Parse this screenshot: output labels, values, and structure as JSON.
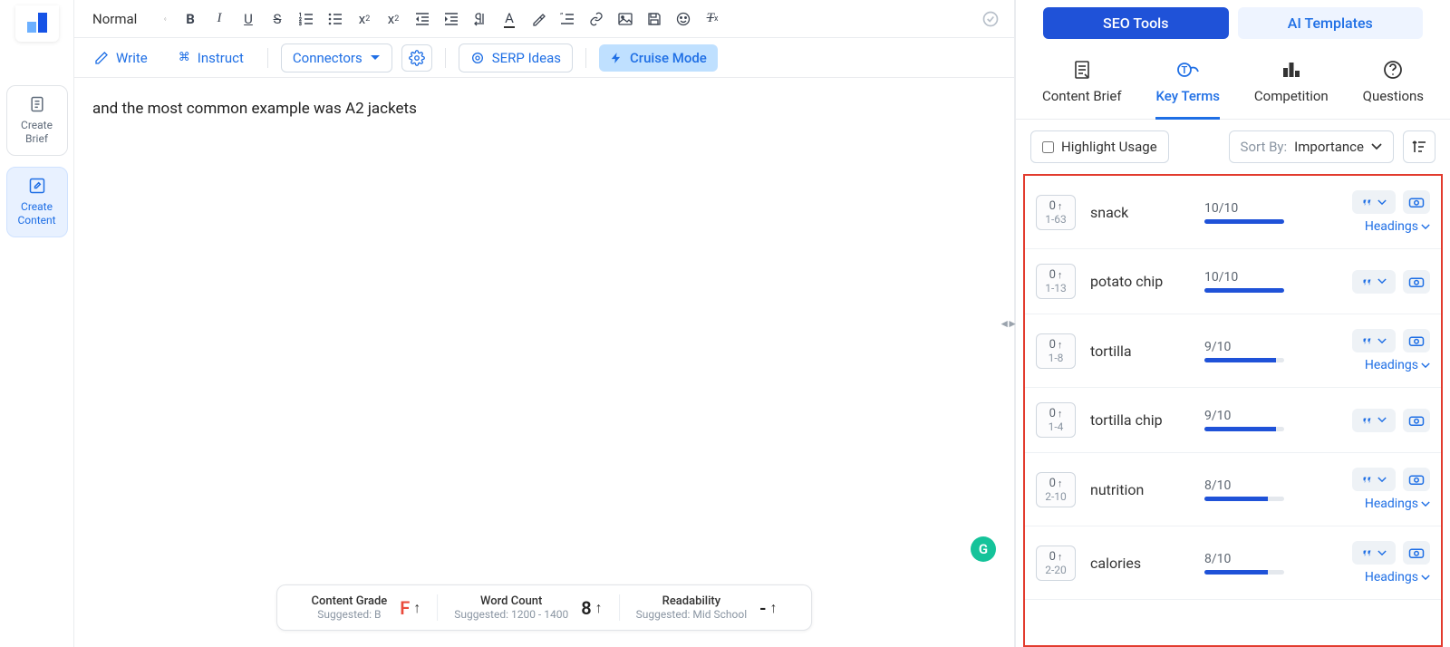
{
  "leftRail": {
    "brief": "Create Brief",
    "content": "Create Content"
  },
  "toolbar1": {
    "format": "Normal"
  },
  "toolbar2": {
    "write": "Write",
    "instruct": "Instruct",
    "connectors": "Connectors",
    "serp": "SERP Ideas",
    "cruise": "Cruise Mode"
  },
  "editor": {
    "content": "and the most common example was A2 jackets"
  },
  "statusBar": {
    "grade": {
      "title": "Content Grade",
      "sub": "Suggested: B",
      "value": "F"
    },
    "words": {
      "title": "Word Count",
      "sub": "Suggested: 1200 - 1400",
      "value": "8"
    },
    "read": {
      "title": "Readability",
      "sub": "Suggested: Mid School",
      "value": "-"
    }
  },
  "rightPanel": {
    "tabs": {
      "seo": "SEO Tools",
      "ai": "AI Templates"
    },
    "subtabs": {
      "brief": "Content Brief",
      "terms": "Key Terms",
      "comp": "Competition",
      "questions": "Questions"
    },
    "highlight": "Highlight Usage",
    "sortLabel": "Sort By:",
    "sortValue": "Importance",
    "headings": "Headings",
    "terms": [
      {
        "count": "0",
        "range": "1-63",
        "name": "snack",
        "score": "10/10",
        "pct": 100,
        "headings": true
      },
      {
        "count": "0",
        "range": "1-13",
        "name": "potato chip",
        "score": "10/10",
        "pct": 100,
        "headings": false
      },
      {
        "count": "0",
        "range": "1-8",
        "name": "tortilla",
        "score": "9/10",
        "pct": 90,
        "headings": true
      },
      {
        "count": "0",
        "range": "1-4",
        "name": "tortilla chip",
        "score": "9/10",
        "pct": 90,
        "headings": false
      },
      {
        "count": "0",
        "range": "2-10",
        "name": "nutrition",
        "score": "8/10",
        "pct": 80,
        "headings": true
      },
      {
        "count": "0",
        "range": "2-20",
        "name": "calories",
        "score": "8/10",
        "pct": 80,
        "headings": true
      }
    ]
  }
}
